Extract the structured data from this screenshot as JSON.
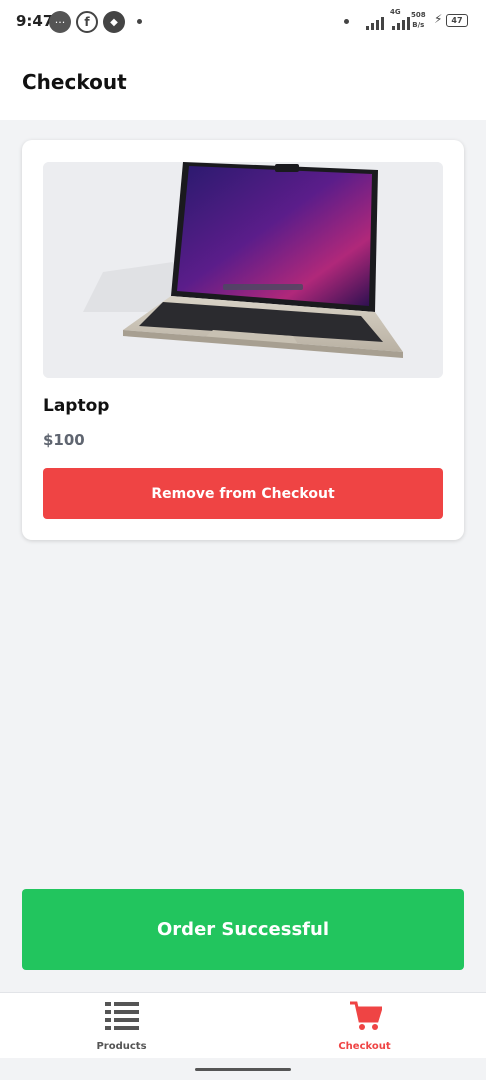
{
  "status_bar": {
    "time": "9:47",
    "network_speed_value": "508",
    "network_speed_unit": "B/s",
    "network_type": "4G",
    "battery_level": "47",
    "icons": [
      "messaging-icon",
      "facebook-icon",
      "app-icon",
      "signal-icon",
      "charging-icon",
      "battery-icon"
    ]
  },
  "header": {
    "title": "Checkout"
  },
  "cart_item": {
    "name": "Laptop",
    "price": "$100",
    "image_icon": "laptop-image",
    "remove_label": "Remove from Checkout"
  },
  "order_button": {
    "label": "Order Successful"
  },
  "bottom_nav": {
    "tabs": [
      {
        "label": "Products",
        "icon": "list-icon",
        "active": false
      },
      {
        "label": "Checkout",
        "icon": "cart-icon",
        "active": true
      }
    ]
  },
  "colors": {
    "remove_button": "#ef4444",
    "order_button": "#22c55e",
    "active_tab": "#ef4444",
    "background": "#f2f3f5"
  }
}
